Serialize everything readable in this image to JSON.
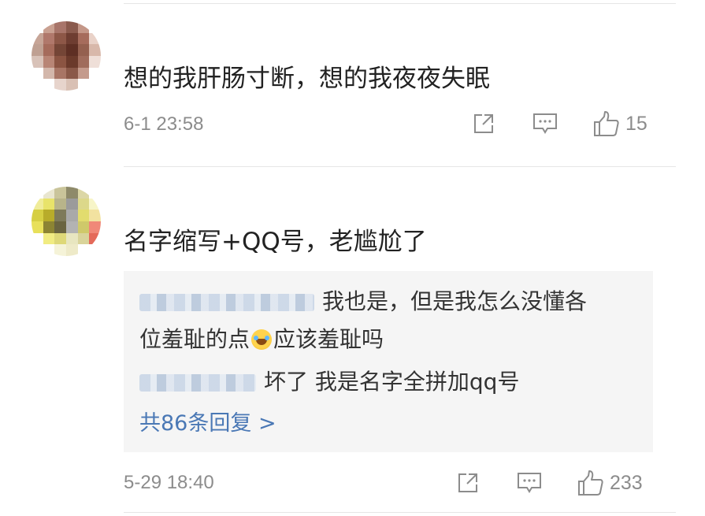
{
  "comments": [
    {
      "text": "想的我肝肠寸断，想的我夜夜失眠",
      "time": "6-1 23:58",
      "likes": "15",
      "avatar_colors": [
        "#fff",
        "#c9a091",
        "#a8756a",
        "#8a5a4d",
        "#c49788",
        "#fff",
        "#c7a597",
        "#b0786b",
        "#8d5747",
        "#6e3d31",
        "#a66c5c",
        "#e9d2c8",
        "#bfa092",
        "#a56b5b",
        "#744536",
        "#5e2f24",
        "#94604f",
        "#d8b8aa",
        "#d8c2b8",
        "#b88575",
        "#8b5442",
        "#6b3a2b",
        "#a06c5c",
        "#efdfd8",
        "#fff",
        "#d3b7ab",
        "#a87565",
        "#8a5848",
        "#c49a8c",
        "#fff",
        "#fff",
        "#fff",
        "#e7d4cc",
        "#d9c0b4",
        "#fff",
        "#fff"
      ]
    },
    {
      "text": "名字缩写+QQ号，老尴尬了",
      "time": "5-29 18:40",
      "likes": "233",
      "avatar_colors": [
        "#fff",
        "#e9e6cf",
        "#c9c49a",
        "#8e8a6a",
        "#dcd7a6",
        "#fff",
        "#f0ec9a",
        "#e8e36a",
        "#b8b48a",
        "#9b9b9b",
        "#dcd88a",
        "#f7f5c8",
        "#d6cf43",
        "#b8ac2a",
        "#7e7a5a",
        "#a9a9a9",
        "#e2dc6e",
        "#f2e2a0",
        "#e8e05a",
        "#8c8433",
        "#6a6440",
        "#b3b3b3",
        "#cfc96a",
        "#f08878",
        "#fff",
        "#f1ec82",
        "#ded878",
        "#e8e6c0",
        "#d9d49a",
        "#e46a5a",
        "#fff",
        "#fff",
        "#f5f3d8",
        "#eeeac8",
        "#fff",
        "#fff"
      ],
      "replies": [
        {
          "text_part1": "我也是，但是我怎么没懂各",
          "text_part2": "位羞耻的点",
          "text_part3": "应该羞耻吗"
        },
        {
          "text": "坏了 我是名字全拼加qq号"
        }
      ],
      "more_replies": "共86条回复 >"
    }
  ],
  "icons": {
    "share": "share-icon",
    "comment": "comment-icon",
    "like": "thumbs-up-icon",
    "emoji": "laugh-cry-emoji-icon"
  }
}
